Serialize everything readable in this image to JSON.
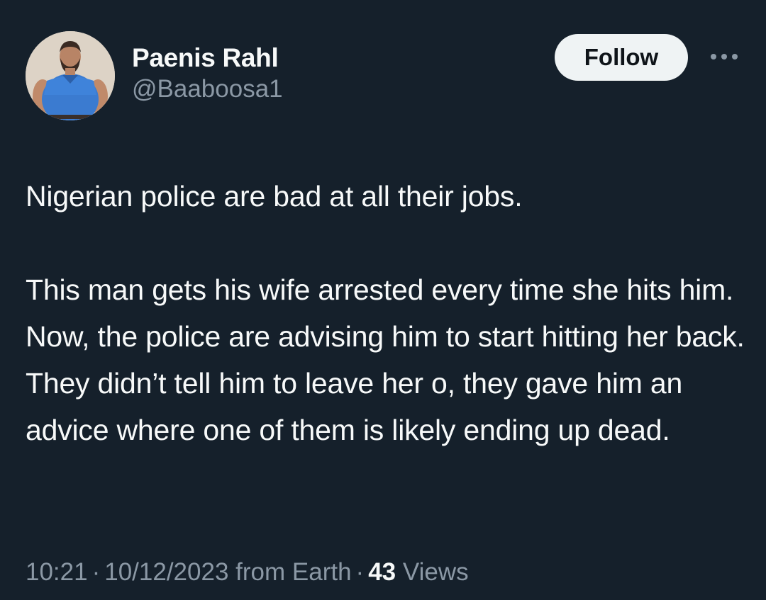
{
  "author": {
    "display_name": "Paenis Rahl",
    "handle": "@Baaboosa1"
  },
  "actions": {
    "follow_label": "Follow",
    "more_icon": "more-horizontal-icon"
  },
  "tweet": {
    "paragraphs": [
      "Nigerian police are bad at all their jobs.",
      "This man gets his wife arrested every time she hits him. Now, the police are advising him to start hitting her back. They didn’t tell him to leave her o, they gave him an advice where one of them is likely ending up dead."
    ]
  },
  "meta": {
    "time": "10:21",
    "separator": "·",
    "date": "10/12/2023",
    "source": "from Earth",
    "views_count": "43",
    "views_label": "Views"
  },
  "colors": {
    "background": "#15202b",
    "text_primary": "#f7f9f9",
    "text_secondary": "#8b98a5",
    "follow_bg": "#eff3f4",
    "avatar_shirt": "#3b7bd0"
  }
}
